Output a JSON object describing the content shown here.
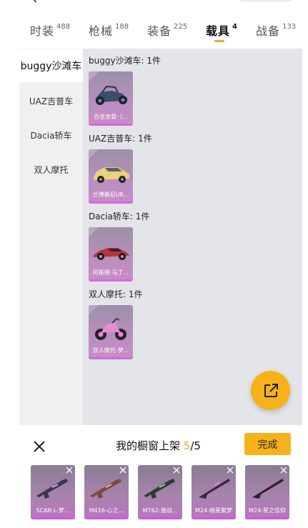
{
  "tabs": [
    {
      "label": "时装",
      "count": "488"
    },
    {
      "label": "枪械",
      "count": "188"
    },
    {
      "label": "装备",
      "count": "225"
    },
    {
      "label": "载具",
      "count": "4"
    },
    {
      "label": "战备",
      "count": "133"
    }
  ],
  "active_tab": "载具",
  "sidebar": {
    "items": [
      {
        "label": "buggy沙滩车"
      },
      {
        "label": "UAZ吉普车"
      },
      {
        "label": "Dacia轿车"
      },
      {
        "label": "双人摩托"
      }
    ]
  },
  "sections": [
    {
      "title": "buggy沙滩车: 1件",
      "item": {
        "name": "合金龙骨（...",
        "icon": "buggy-icon"
      }
    },
    {
      "title": "UAZ吉普车: 1件",
      "item": {
        "name": "兰博基尼UR...",
        "icon": "suv-icon"
      }
    },
    {
      "title": "Dacia轿车: 1件",
      "item": {
        "name": "阿斯顿·马丁...",
        "icon": "sports-car-icon"
      }
    },
    {
      "title": "双人摩托: 1件",
      "item": {
        "name": "双人摩托-梦...",
        "icon": "motorcycle-icon"
      }
    }
  ],
  "bottom": {
    "title_prefix": "我的橱窗上架 ",
    "current": "5",
    "total": "/5",
    "done_label": "完成",
    "slots": [
      {
        "name": "SCAR-L-梦...",
        "icon": "rifle-icon"
      },
      {
        "name": "M416-心之...",
        "icon": "rifle-icon"
      },
      {
        "name": "M762-激战...",
        "icon": "rifle-icon"
      },
      {
        "name": "M24-暗星紫梦",
        "icon": "sniper-rifle-icon"
      },
      {
        "name": "M24-星之信仰",
        "icon": "sniper-rifle-icon"
      }
    ],
    "hint": ""
  },
  "colors": {
    "accent": "#f7b21b",
    "rarity_purple": "#d16bd6",
    "content_bg": "#e3e5e8",
    "sidebar_bg": "#eff0f2"
  }
}
